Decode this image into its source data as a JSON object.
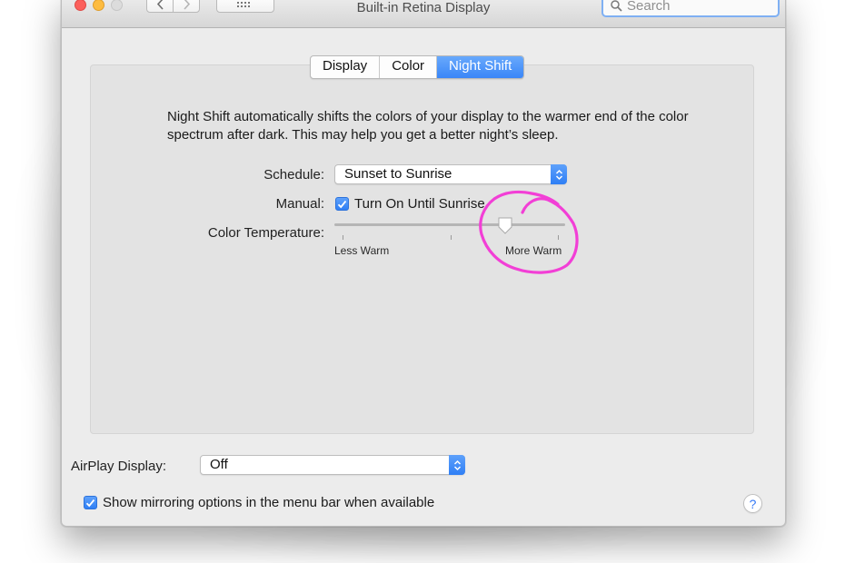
{
  "window": {
    "title": "Built-in Retina Display"
  },
  "toolbar": {
    "search_placeholder": "Search"
  },
  "tabs": [
    {
      "label": "Display",
      "active": false
    },
    {
      "label": "Color",
      "active": false
    },
    {
      "label": "Night Shift",
      "active": true
    }
  ],
  "night_shift": {
    "description": "Night Shift automatically shifts the colors of your display to the warmer end of the color spectrum after dark. This may help you get a better night’s sleep.",
    "schedule_label": "Schedule:",
    "schedule_value": "Sunset to Sunrise",
    "manual_label": "Manual:",
    "manual_checkbox_label": "Turn On Until Sunrise",
    "manual_checked": true,
    "temperature_label": "Color Temperature:",
    "temperature_min_label": "Less Warm",
    "temperature_max_label": "More Warm",
    "temperature_level": 0.76
  },
  "footer": {
    "airplay_label": "AirPlay Display:",
    "airplay_value": "Off",
    "mirroring_label": "Show mirroring options in the menu bar when available",
    "mirroring_checked": true,
    "help_label": "?"
  },
  "colors": {
    "accent": "#3a86f7",
    "annotation": "#f23fd6",
    "panel_background": "#e3e3e3",
    "window_background": "#ececec"
  },
  "icons": {
    "close": "close-traffic-light-icon",
    "minimize": "minimize-traffic-light-icon",
    "zoom": "zoom-traffic-light-icon",
    "back": "chevron-left-icon",
    "forward": "chevron-right-icon",
    "grid": "grid-icon",
    "search": "search-icon",
    "popup": "up-down-chevron-icon",
    "checkbox": "checkmark-icon",
    "help": "help-icon"
  }
}
